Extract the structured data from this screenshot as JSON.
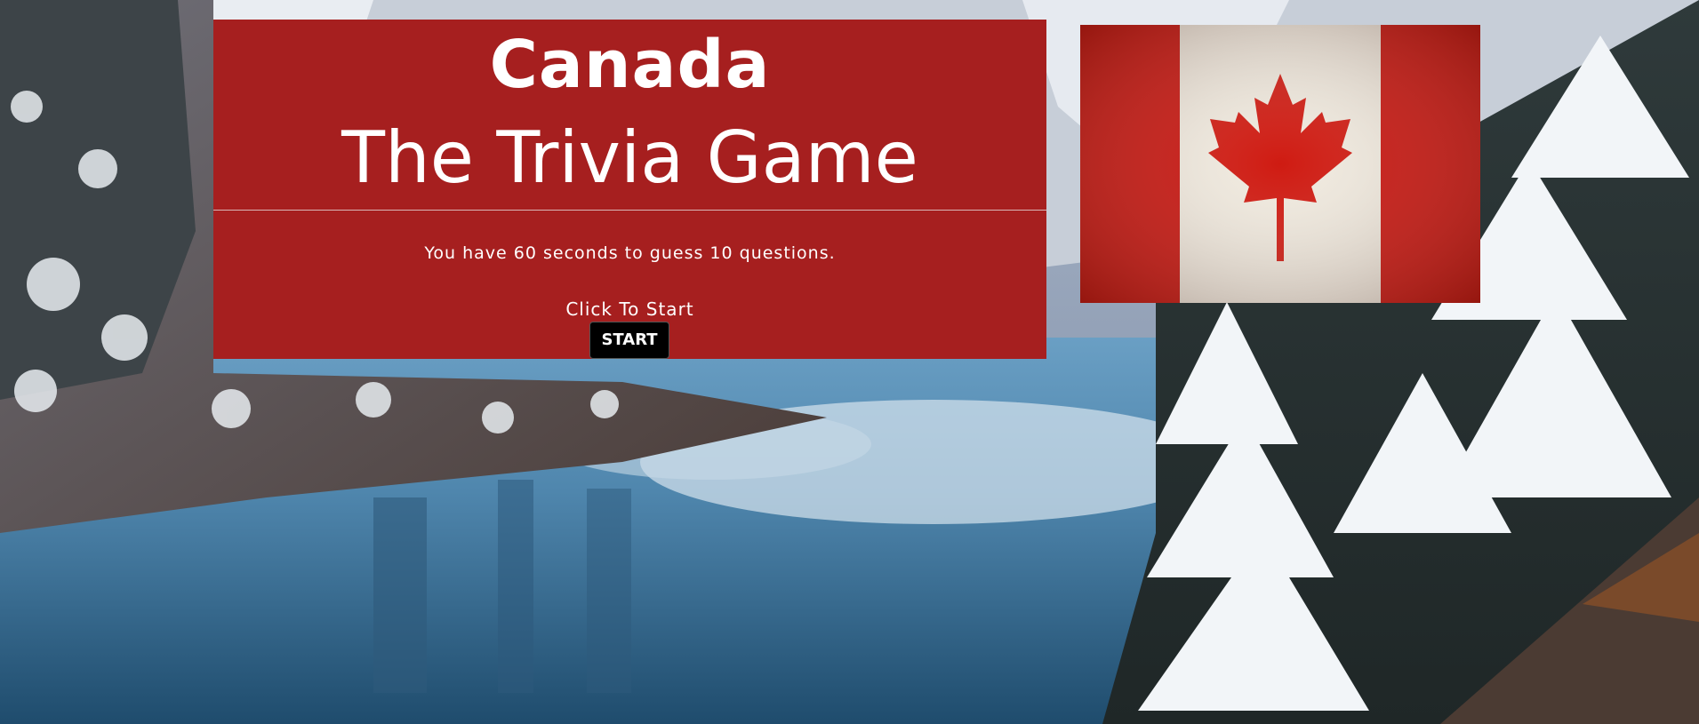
{
  "header": {
    "title_line1": "Canada",
    "title_line2": "The Trivia Game"
  },
  "intro": {
    "instructions": "You have 60 seconds to guess 10 questions.",
    "click_label": "Click To Start",
    "start_button": "START"
  },
  "colors": {
    "panel": "#a61f1f",
    "button": "#000000",
    "flag_red": "#c8150f",
    "flag_white": "#efe9de"
  },
  "images": {
    "background": "snowy-mountain-lake-background",
    "flag": "canada-flag-icon"
  }
}
